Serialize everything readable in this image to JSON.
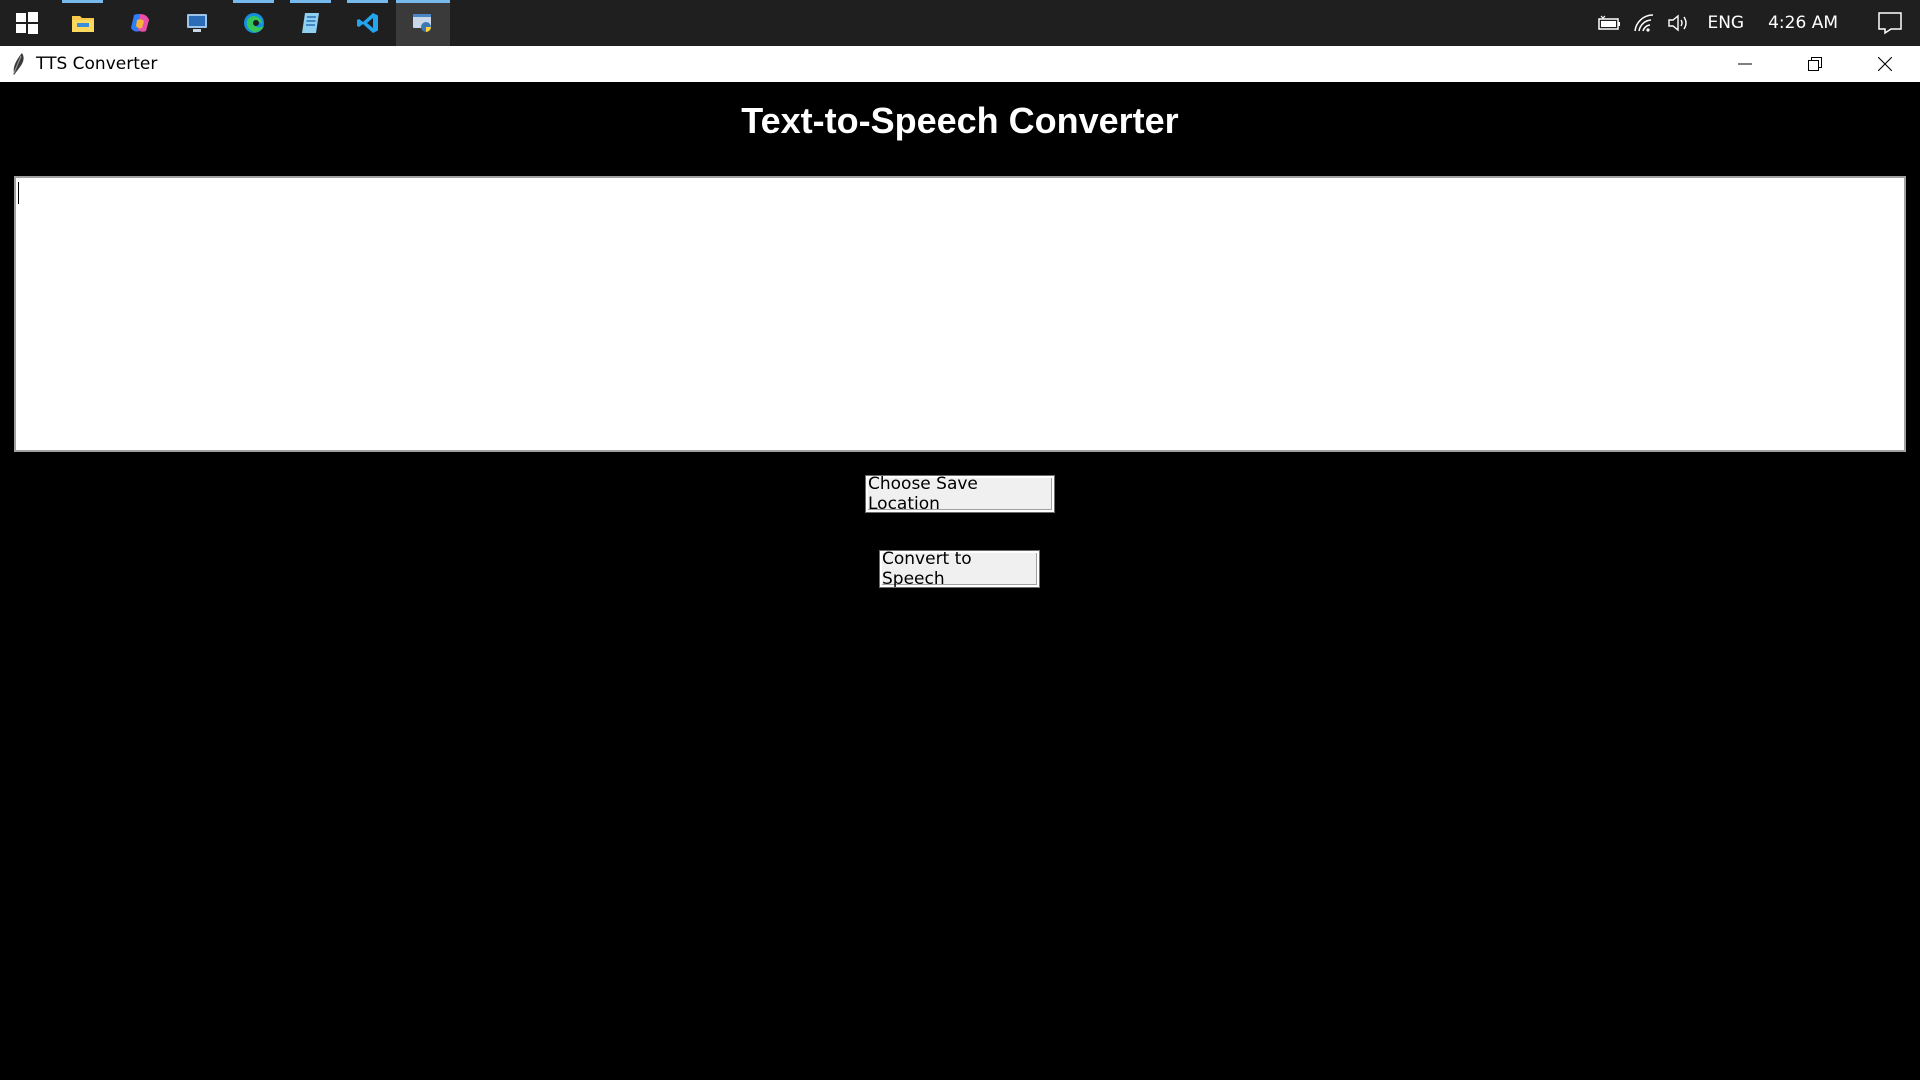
{
  "taskbar": {
    "start_icon": "windows-logo-icon",
    "apps": [
      {
        "name": "file-explorer-icon",
        "running": true
      },
      {
        "name": "copilot-icon",
        "running": false
      },
      {
        "name": "remote-desktop-icon",
        "running": false
      },
      {
        "name": "edge-icon",
        "running": true
      },
      {
        "name": "notepad-icon",
        "running": true
      },
      {
        "name": "vscode-icon",
        "running": true
      },
      {
        "name": "python-tk-icon",
        "running": true,
        "active": true
      }
    ],
    "tray": {
      "battery_icon": "battery-icon",
      "network_icon": "wifi-icon",
      "volume_icon": "volume-icon",
      "language": "ENG",
      "time": "4:26 AM",
      "notification_icon": "action-center-icon"
    }
  },
  "window": {
    "title": "TTS Converter",
    "title_icon": "feather-icon",
    "controls": [
      "minimize-icon",
      "restore-icon",
      "close-icon"
    ]
  },
  "app": {
    "heading": "Text-to-Speech Converter",
    "text_input_value": "",
    "choose_save_label": "Choose Save Location",
    "convert_label": "Convert to Speech"
  },
  "colors": {
    "taskbar_bg": "#1f1f1f",
    "app_bg": "#000000",
    "heading": "#ffffff",
    "accent": "#76b9ed"
  }
}
